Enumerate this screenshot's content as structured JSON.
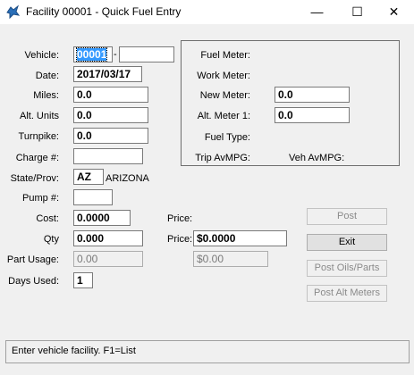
{
  "window": {
    "title": "Facility 00001 - Quick Fuel Entry",
    "minimize": "—",
    "maximize": "☐",
    "close": "✕"
  },
  "form": {
    "vehicle_label": "Vehicle:",
    "vehicle_value": "00001",
    "vehicle_dash": "-",
    "vehicle_sub_value": "",
    "date_label": "Date:",
    "date_value": "2017/03/17",
    "miles_label": "Miles:",
    "miles_value": "0.0",
    "alt_units_label": "Alt. Units",
    "alt_units_value": "0.0",
    "turnpike_label": "Turnpike:",
    "turnpike_value": "0.0",
    "charge_label": "Charge #:",
    "charge_value": "",
    "state_label": "State/Prov:",
    "state_value": "AZ",
    "state_name": "ARIZONA",
    "pump_label": "Pump #:",
    "pump_value": "",
    "cost_label": "Cost:",
    "cost_value": "0.0000",
    "qty_label": "Qty",
    "qty_value": "0.000",
    "part_usage_label": "Part Usage:",
    "part_usage_value": "0.00",
    "days_used_label": "Days Used:",
    "days_used_value": "1",
    "price_label_top": "Price:",
    "price_label": "Price:",
    "price_value": "$0.0000",
    "price_total_value": "$0.00"
  },
  "meters": {
    "fuel_meter_label": "Fuel Meter:",
    "work_meter_label": "Work Meter:",
    "new_meter_label": "New  Meter:",
    "new_meter_value": "0.0",
    "alt_meter_label": "Alt. Meter 1:",
    "alt_meter_value": "0.0",
    "fuel_type_label": "Fuel Type:",
    "trip_avmpg_label": "Trip AvMPG:",
    "veh_avmpg_label": "Veh AvMPG:"
  },
  "buttons": {
    "post": "Post",
    "exit": "Exit",
    "post_oils": "Post Oils/Parts",
    "post_alt_meters": "Post Alt Meters"
  },
  "status": {
    "message": "Enter vehicle facility. F1=List"
  },
  "colors": {
    "selection": "#3399ff",
    "window_bg": "#f0f0f0"
  }
}
